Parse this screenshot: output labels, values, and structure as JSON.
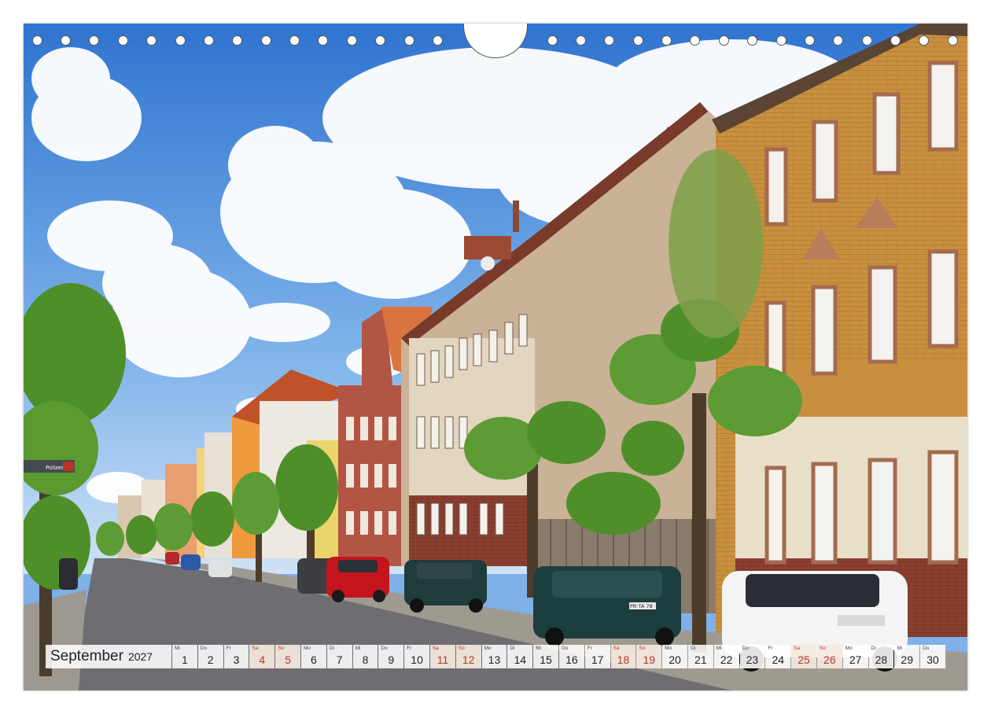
{
  "calendar": {
    "month": "September",
    "year": "2027",
    "weekdays": [
      "Mi",
      "Do",
      "Fr",
      "Sa",
      "So",
      "Mo",
      "Di",
      "Mi",
      "Do",
      "Fr",
      "Sa",
      "So",
      "Mo",
      "Di",
      "Mi",
      "Do",
      "Fr",
      "Sa",
      "So",
      "Mo",
      "Di",
      "Mi",
      "Do",
      "Fr",
      "Sa",
      "So",
      "Mo",
      "Di",
      "Mi",
      "Do"
    ],
    "days": [
      "1",
      "2",
      "3",
      "4",
      "5",
      "6",
      "7",
      "8",
      "9",
      "10",
      "11",
      "12",
      "13",
      "14",
      "15",
      "16",
      "17",
      "18",
      "19",
      "20",
      "21",
      "22",
      "23",
      "24",
      "25",
      "26",
      "27",
      "28",
      "29",
      "30"
    ],
    "weekend_indices": [
      3,
      4,
      10,
      11,
      17,
      18,
      24,
      25
    ]
  },
  "photo": {
    "sign_text": "Polizei",
    "plate_text": "PR·TA 78"
  },
  "colors": {
    "weekend_text": "#b03a2e",
    "sky_top": "#3d7fd6",
    "facade_yellow": "#c99a45"
  }
}
